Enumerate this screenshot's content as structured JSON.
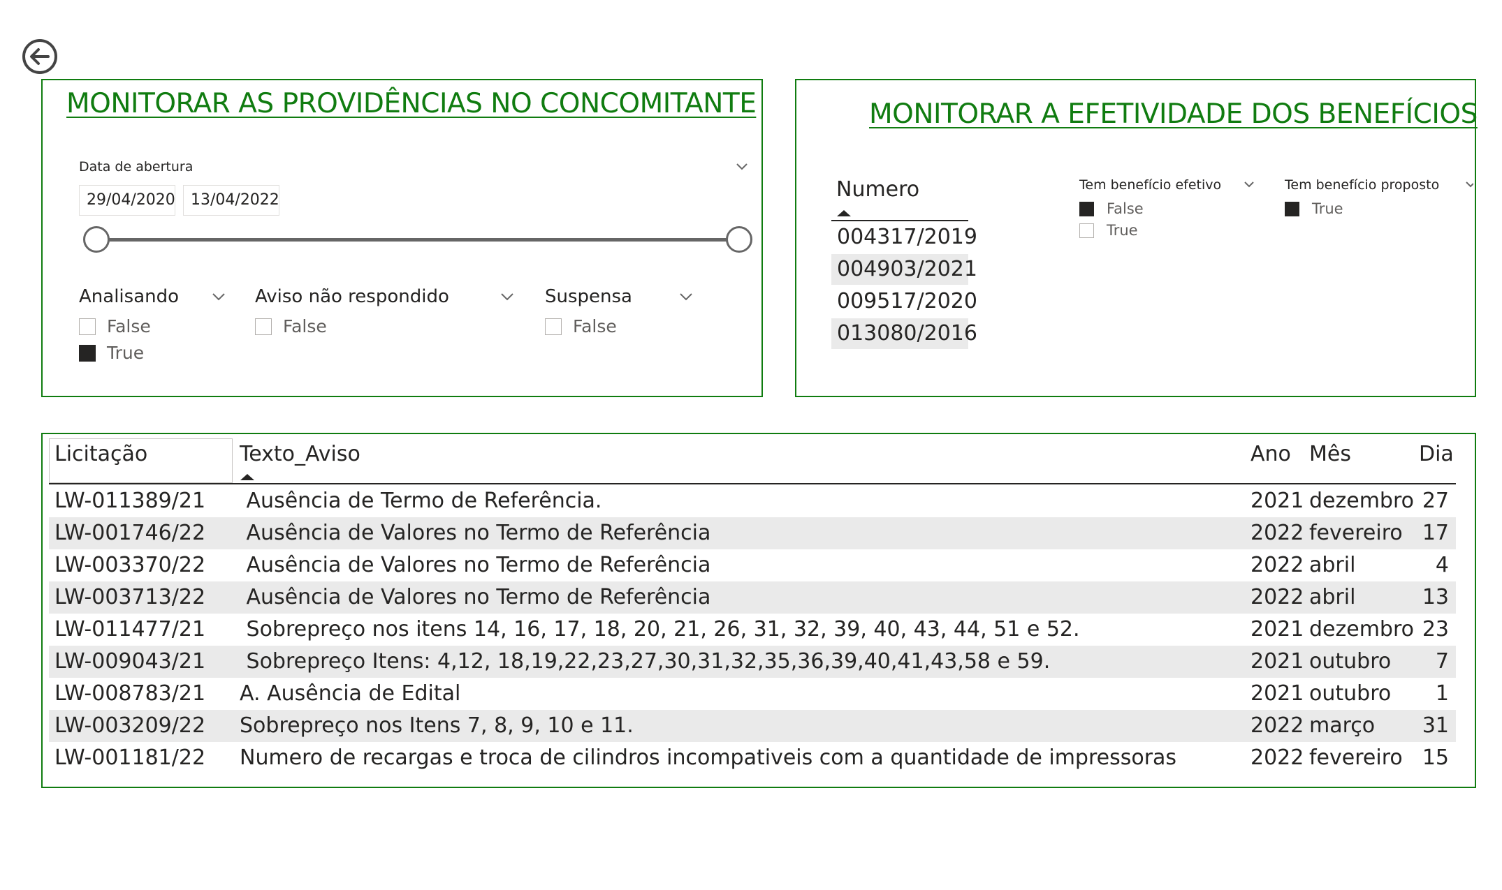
{
  "panel_left": {
    "title": "MONITORAR AS PROVIDÊNCIAS NO CONCOMITANTE",
    "date_slicer": {
      "label": "Data de abertura",
      "start": "29/04/2020",
      "end": "13/04/2022"
    },
    "slicers": [
      {
        "title": "Analisando",
        "options": [
          {
            "label": "False",
            "checked": false
          },
          {
            "label": "True",
            "checked": true
          }
        ]
      },
      {
        "title": "Aviso não respondido",
        "options": [
          {
            "label": "False",
            "checked": false
          }
        ]
      },
      {
        "title": "Suspensa",
        "options": [
          {
            "label": "False",
            "checked": false
          }
        ]
      }
    ]
  },
  "panel_right": {
    "title": "MONITORAR A EFETIVIDADE DOS BENEFÍCIOS",
    "numero": {
      "header": "Numero",
      "items": [
        "004317/2019",
        "004903/2021",
        "009517/2020",
        "013080/2016"
      ]
    },
    "slicers": [
      {
        "title": "Tem benefício efetivo",
        "options": [
          {
            "label": "False",
            "checked": true
          },
          {
            "label": "True",
            "checked": false
          }
        ]
      },
      {
        "title": "Tem benefício proposto",
        "options": [
          {
            "label": "True",
            "checked": true
          }
        ]
      }
    ]
  },
  "table": {
    "columns": [
      "Licitação",
      "Texto_Aviso",
      "Ano",
      "Mês",
      "Dia"
    ],
    "rows": [
      [
        "LW-011389/21",
        " Ausência de Termo de Referência.",
        "2021",
        "dezembro",
        "27"
      ],
      [
        "LW-001746/22",
        " Ausência de Valores no Termo de Referência",
        "2022",
        "fevereiro",
        "17"
      ],
      [
        "LW-003370/22",
        " Ausência de Valores no Termo de Referência",
        "2022",
        "abril",
        "4"
      ],
      [
        "LW-003713/22",
        " Ausência de Valores no Termo de Referência",
        "2022",
        "abril",
        "13"
      ],
      [
        "LW-011477/21",
        " Sobrepreço nos itens 14, 16, 17, 18, 20, 21, 26, 31, 32, 39, 40, 43, 44, 51 e 52.",
        "2021",
        "dezembro",
        "23"
      ],
      [
        "LW-009043/21",
        " Sobrepreço Itens: 4,12, 18,19,22,23,27,30,31,32,35,36,39,40,41,43,58 e 59.",
        "2021",
        "outubro",
        "7"
      ],
      [
        "LW-008783/21",
        "A. Ausência de Edital",
        "2021",
        "outubro",
        "1"
      ],
      [
        "LW-003209/22",
        "Sobrepreço nos Itens 7, 8, 9, 10 e 11.",
        "2022",
        "março",
        "31"
      ],
      [
        "LW-001181/22",
        "Numero de recargas e troca de cilindros incompativeis com a quantidade de impressoras",
        "2022",
        "fevereiro",
        "15"
      ]
    ]
  },
  "colors": {
    "accent": "#107c10",
    "checked": "#252423",
    "row_alt": "#eaeaea"
  }
}
